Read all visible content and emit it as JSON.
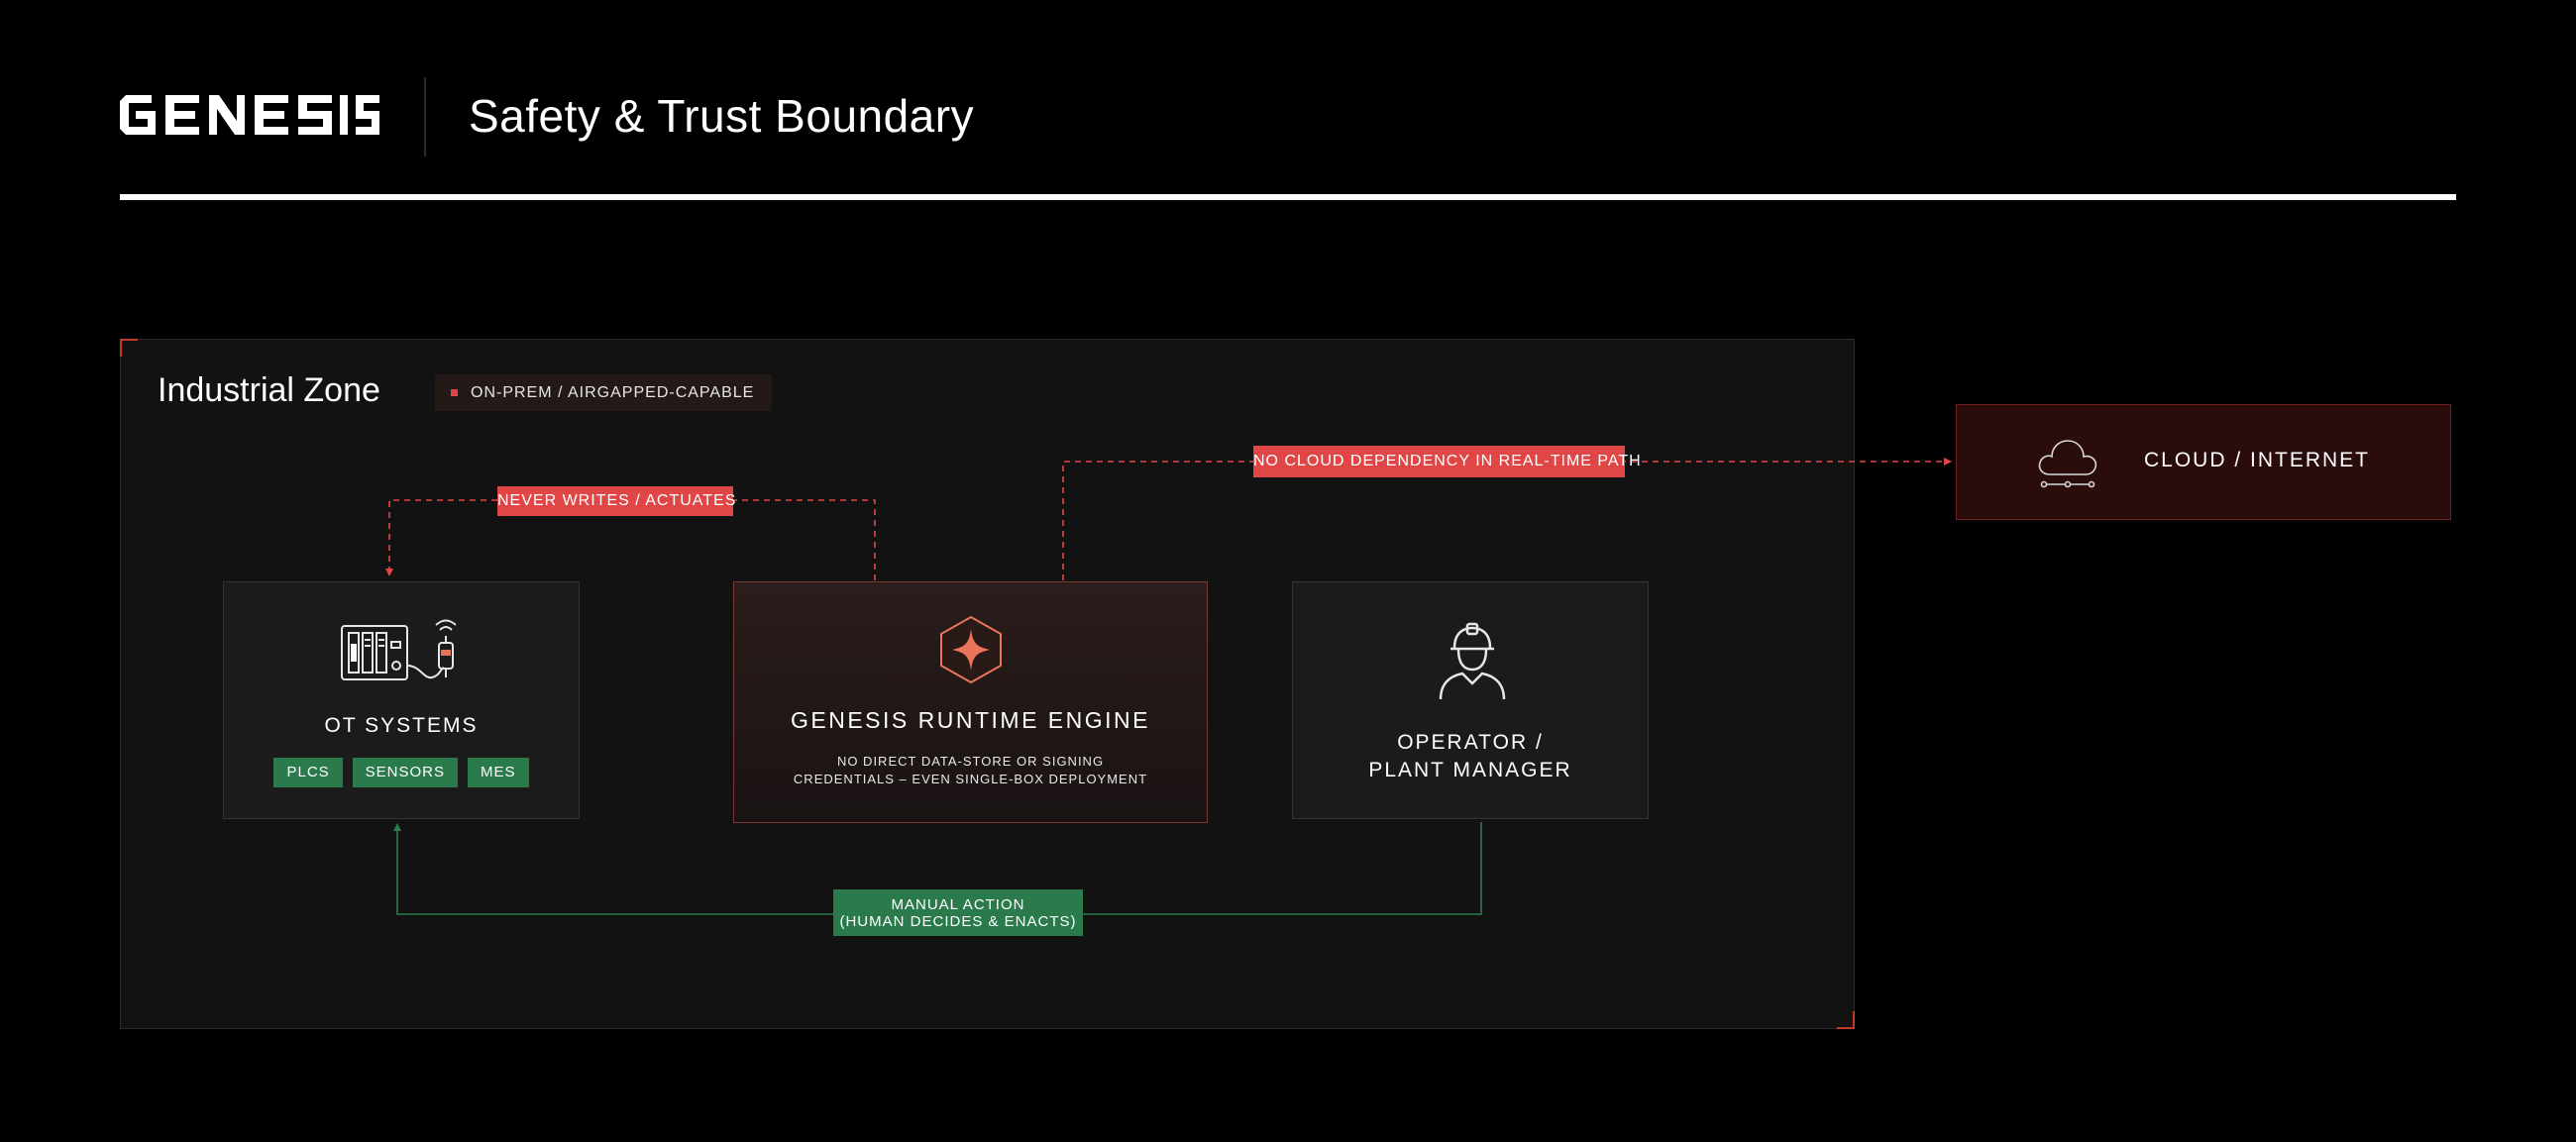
{
  "header": {
    "logo_text": "GENESIS",
    "title": "Safety & Trust Boundary"
  },
  "zone": {
    "title": "Industrial Zone",
    "badge": "ON-PREM / AIRGAPPED-CAPABLE"
  },
  "nodes": {
    "ot": {
      "label": "OT SYSTEMS",
      "tags": [
        "PLCS",
        "SENSORS",
        "MES"
      ],
      "icon": "plc-sensor-icon"
    },
    "engine": {
      "label": "GENESIS RUNTIME ENGINE",
      "sub_line1": "NO DIRECT DATA-STORE OR SIGNING",
      "sub_line2": "CREDENTIALS – EVEN SINGLE-BOX DEPLOYMENT",
      "icon": "hexagon-star-icon"
    },
    "operator": {
      "label_line1": "OPERATOR /",
      "label_line2": "PLANT MANAGER",
      "icon": "worker-hardhat-icon"
    },
    "cloud": {
      "label": "CLOUD / INTERNET",
      "icon": "cloud-network-icon"
    }
  },
  "edges": {
    "never_writes": "NEVER WRITES / ACTUATES",
    "no_cloud": "NO CLOUD DEPENDENCY IN REAL-TIME PATH",
    "manual_line1": "MANUAL ACTION",
    "manual_line2": "(HUMAN DECIDES & ENACTS)"
  },
  "colors": {
    "accent_red": "#e14646",
    "accent_green": "#2b7a4b",
    "engine_border": "#7a3a30",
    "cloud_bg": "#2a0c0c",
    "background": "#000000",
    "zone_bg": "#121212"
  }
}
